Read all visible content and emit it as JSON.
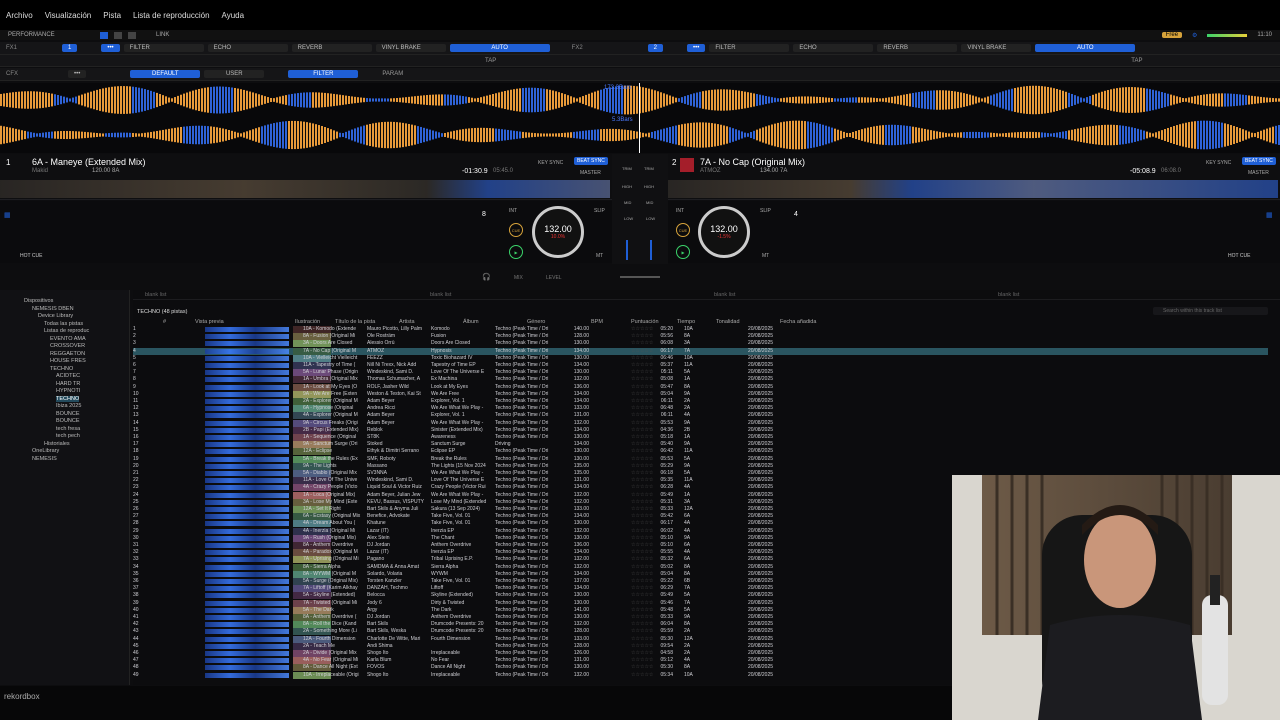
{
  "menu": [
    "Archivo",
    "Visualización",
    "Pista",
    "Lista de reproducción",
    "Ayuda"
  ],
  "topbar": {
    "mode": "PERFORMANCE",
    "link": "LINK",
    "plan": "Free",
    "time": "11:10"
  },
  "fx1": {
    "label": "FX1",
    "effects": [
      "FILTER",
      "ECHO",
      "REVERB",
      "VINYL BRAKE"
    ],
    "auto": "AUTO",
    "tap": "TAP"
  },
  "fx2": {
    "label": "FX2",
    "effects": [
      "FILTER",
      "ECHO",
      "REVERB",
      "VINYL BRAKE"
    ],
    "auto": "AUTO",
    "tap": "TAP"
  },
  "cfx": {
    "label": "CFX",
    "default": "DEFAULT",
    "user": "USER",
    "filter": "FILTER",
    "param": "PARAM"
  },
  "wave_overlay": {
    "bars1": "173.3Bars",
    "bars2": "5.3Bars"
  },
  "deck1": {
    "num": "1",
    "title": "6A - Maneye (Extended Mix)",
    "artist": "Makid",
    "bpm_key": "120.00 8A",
    "time_elapsed": "-01:30.9",
    "time_total": "05:45.0",
    "keysync": "KEY SYNC",
    "beatsync": "BEAT SYNC",
    "master": "MASTER",
    "bpm": "132.00",
    "pitch": "10.0%",
    "int": "INT",
    "slip": "SLIP",
    "cue": "CUE",
    "mt": "MT",
    "beat": "8",
    "hotcue": "HOT CUE"
  },
  "deck2": {
    "num": "2",
    "title": "7A - No Cap (Original Mix)",
    "artist": "ATMOZ",
    "bpm_key": "134.00 7A",
    "time_elapsed": "-05:08.9",
    "time_total": "06:08.0",
    "keysync": "KEY SYNC",
    "beatsync": "BEAT SYNC",
    "master": "MASTER",
    "bpm": "132.00",
    "pitch": "-1.5%",
    "int": "INT",
    "slip": "SLIP",
    "cue": "CUE",
    "mt": "MT",
    "beat": "4",
    "hotcue": "HOT CUE"
  },
  "mixer": {
    "trim": "TRIM",
    "high": "HIGH",
    "mid": "MID",
    "low": "LOW",
    "cue": "CUE",
    "mix": "MIX",
    "level": "LEVEL"
  },
  "sidebar": {
    "items": [
      {
        "label": "Dispositivos"
      },
      {
        "label": "NEMESIS DBEN"
      },
      {
        "label": "Device Library"
      },
      {
        "label": "Todas las pistas"
      },
      {
        "label": "Listas de reproduc"
      },
      {
        "label": "EVENTO AMA"
      },
      {
        "label": "CROSSOVER"
      },
      {
        "label": "REGGAETON"
      },
      {
        "label": "HOUSE FRES"
      },
      {
        "label": "TECHNO"
      },
      {
        "label": "ACIDTEC"
      },
      {
        "label": "HARD TR"
      },
      {
        "label": "HYPNOTI"
      },
      {
        "label": "TECHNO"
      },
      {
        "label": "Ibiza 2025"
      },
      {
        "label": "BOUNCE"
      },
      {
        "label": "BOUNCE"
      },
      {
        "label": "tech fresa"
      },
      {
        "label": "tech pech"
      },
      {
        "label": "Historiales"
      },
      {
        "label": "OneLibrary"
      },
      {
        "label": "NEMESIS"
      }
    ],
    "logo": "rekordbox"
  },
  "tracks": {
    "tabs": [
      "blank list",
      "blank list",
      "blank list",
      "blank list"
    ],
    "playlist": "TECHNO (48 pistas)",
    "search_placeholder": "Search within this track list",
    "headers": [
      "#",
      "Vista previa",
      "Ilustración",
      "Título de la pista",
      "Artista",
      "Álbum",
      "Género",
      "BPM",
      "Puntuación",
      "Tiempo",
      "Tonalidad",
      "Fecha añadida"
    ],
    "rows": [
      [
        "1",
        "10A - Komodo (Extende",
        "Mauro Picotto, Lilly Palm",
        "Komodo",
        "Techno (Peak Time / Dri",
        "140.00",
        "05:20",
        "10A",
        "20/08/2025"
      ],
      [
        "2",
        "8A - Fusion (Original Mi",
        "Ole Rosträm",
        "Fusion",
        "Techno (Peak Time / Dri",
        "128.00",
        "05:56",
        "8A",
        "20/08/2025"
      ],
      [
        "3",
        "3A - Doors Are Closed",
        "Alessio Orrù",
        "Doors Are Closed",
        "Techno (Peak Time / Dri",
        "130.00",
        "06:08",
        "3A",
        "20/08/2025"
      ],
      [
        "4",
        "7A - No Cap (Original M",
        "ATMOZ",
        "Hypnosis",
        "Techno (Peak Time / Dri",
        "134.00",
        "06:17",
        "7A",
        "20/08/2025"
      ],
      [
        "5",
        "10A - Vielleicht Vielleicht",
        "FEEZZ",
        "Toxic Biohazard IV",
        "Techno (Peak Time / Dri",
        "130.00",
        "06:46",
        "10A",
        "20/08/2025"
      ],
      [
        "6",
        "11A - Tapestry of Time (",
        "Nill Ni Trexx, Nick Add",
        "Tapestry of Time EP",
        "Techno (Peak Time / Dri",
        "134.00",
        "05:37",
        "11A",
        "20/08/2025"
      ],
      [
        "7",
        "5A - Lunar Phase (Origin",
        "Windeskind, Sami D.",
        "Love Of The Universe E",
        "Techno (Peak Time / Dri",
        "130.00",
        "05:11",
        "5A",
        "20/08/2025"
      ],
      [
        "8",
        "1A - Umbra (Original Mix",
        "Thomas Schumacher, A",
        "Ex Machina",
        "Techno (Peak Time / Dri",
        "132.00",
        "05:08",
        "1A",
        "20/08/2025"
      ],
      [
        "9",
        "1A - Look at My Eyes (O",
        "ROLF, Jasher Wild",
        "Look at My Eyes",
        "Techno (Peak Time / Dri",
        "136.00",
        "05:47",
        "8A",
        "20/08/2025"
      ],
      [
        "10",
        "9A - We Are Free (Exten",
        "Weston & Teston, Kai St",
        "We Are Free",
        "Techno (Peak Time / Dri",
        "134.00",
        "05:04",
        "9A",
        "20/08/2025"
      ],
      [
        "11",
        "2A - Explorer (Original M",
        "Adam Beyer",
        "Explorer, Vol. 1",
        "Techno (Peak Time / Dri",
        "134.00",
        "06:11",
        "2A",
        "20/08/2025"
      ],
      [
        "12",
        "6A - Hypnose (Original",
        "Andrea Ricci",
        "We Are What We Play -",
        "Techno (Peak Time / Dri",
        "133.00",
        "06:48",
        "2A",
        "20/08/2025"
      ],
      [
        "13",
        "4A - Explorer (Original M",
        "Adam Beyer",
        "Explorer, Vol. 1",
        "Techno (Peak Time / Dri",
        "131.00",
        "06:11",
        "4A",
        "20/08/2025"
      ],
      [
        "14",
        "9A - Circus Freaks (Origi",
        "Adam Beyer",
        "We Are What We Play -",
        "Techno (Peak Time / Dri",
        "132.00",
        "05:53",
        "9A",
        "20/08/2025"
      ],
      [
        "15",
        "2B - Papi (Extended Mix)",
        "Reblok",
        "Sinister (Extended Mix)",
        "Techno (Peak Time / Dri",
        "134.00",
        "04:36",
        "2B",
        "20/08/2025"
      ],
      [
        "16",
        "1A - Sequence (Original",
        "ST8K",
        "Awareness",
        "Techno (Peak Time / Dri",
        "130.00",
        "05:18",
        "1A",
        "20/08/2025"
      ],
      [
        "17",
        "9A - Sanctum Surge (Ori",
        "Stoked",
        "Sanctum Surge",
        "Driving",
        "134.00",
        "05:40",
        "9A",
        "20/08/2025"
      ],
      [
        "18",
        "12A - Eclipse",
        "Ethyk & Dimitri Serrano",
        "Eclipse EP",
        "Techno (Peak Time / Dri",
        "130.00",
        "06:42",
        "11A",
        "20/08/2025"
      ],
      [
        "19",
        "5A - Break the Rules (Ex",
        "SMF, Roboty",
        "Break the Rules",
        "Techno (Peak Time / Dri",
        "130.00",
        "05:53",
        "5A",
        "20/08/2025"
      ],
      [
        "20",
        "9A - The Lights",
        "Massano",
        "The Lights (15 Nov 2024",
        "Techno (Peak Time / Dri",
        "135.00",
        "05:29",
        "9A",
        "20/08/2025"
      ],
      [
        "21",
        "5A - Diablo (Original Mix",
        "SV3NNA",
        "We Are What We Play -",
        "Techno (Peak Time / Dri",
        "135.00",
        "06:18",
        "5A",
        "20/08/2025"
      ],
      [
        "22",
        "11A - Love Of The Unive",
        "Windeskind, Sami D.",
        "Love Of The Universe E",
        "Techno (Peak Time / Dri",
        "131.00",
        "05:35",
        "11A",
        "20/08/2025"
      ],
      [
        "23",
        "4A - Crazy People (Victo",
        "Liquid Soul & Victor Ruiz",
        "Crazy People (Victor Rui",
        "Techno (Peak Time / Dri",
        "134.00",
        "06:28",
        "4A",
        "20/08/2025"
      ],
      [
        "24",
        "1A - Loca (Original Mix)",
        "Adam Beyer, Julian Jew",
        "We Are What We Play -",
        "Techno (Peak Time / Dri",
        "132.00",
        "05:49",
        "1A",
        "20/08/2025"
      ],
      [
        "25",
        "3A - Lose My Mind (Exte",
        "KEVU, Bassus, VISPUTY",
        "Lose My Mind (Extended",
        "Techno (Peak Time / Dri",
        "132.00",
        "05:31",
        "3A",
        "20/08/2025"
      ],
      [
        "26",
        "12A - Set It Right",
        "Bart Skils & Anyma Juli",
        "Sakura (13 Sep 2024)",
        "Techno (Peak Time / Dri",
        "133.00",
        "05:33",
        "12A",
        "20/08/2025"
      ],
      [
        "27",
        "6A - Ecstasy (Original Mix",
        "Benefice, Advokate",
        "Take Five, Vol. 01",
        "Techno (Peak Time / Dri",
        "134.00",
        "05:42",
        "6A",
        "20/08/2025"
      ],
      [
        "28",
        "4A - Dream About You (",
        "Khatune",
        "Take Five, Vol. 01",
        "Techno (Peak Time / Dri",
        "130.00",
        "06:17",
        "4A",
        "20/08/2025"
      ],
      [
        "29",
        "4A - Inerzia (Original Mi",
        "Lazar (IT)",
        "Inerzia EP",
        "Techno (Peak Time / Dri",
        "132.00",
        "06:02",
        "4A",
        "20/08/2025"
      ],
      [
        "30",
        "9A - Rush (Original Mix)",
        "Alex Stein",
        "The Chant",
        "Techno (Peak Time / Dri",
        "130.00",
        "05:10",
        "9A",
        "20/08/2025"
      ],
      [
        "31",
        "8A - Anthem Overdrive",
        "DJ Jordan",
        "Anthem Overdrive",
        "Techno (Peak Time / Dri",
        "136.00",
        "05:10",
        "6A",
        "20/08/2025"
      ],
      [
        "32",
        "4A - Paradox (Original M",
        "Lazar (IT)",
        "Inerzia EP",
        "Techno (Peak Time / Dri",
        "134.00",
        "05:55",
        "4A",
        "20/08/2025"
      ],
      [
        "33",
        "7A - Uprising (Original Mi",
        "Pagano",
        "Tribal Uprising E.P.",
        "Techno (Peak Time / Dri",
        "132.00",
        "05:32",
        "6A",
        "20/08/2025"
      ],
      [
        "34",
        "8A - Sierra Alpha",
        "SAMDMA & Anna Amat",
        "Sierra Alpha",
        "Techno (Peak Time / Dri",
        "132.00",
        "05:02",
        "8A",
        "20/08/2025"
      ],
      [
        "35",
        "8A - WYWM (Original M",
        "Solardo, Volaria",
        "WYWM",
        "Techno (Peak Time / Dri",
        "134.00",
        "05:04",
        "8A",
        "20/08/2025"
      ],
      [
        "36",
        "5A - Surge (Original Mix)",
        "Torsten Kanzler",
        "Take Five, Vol. 01",
        "Techno (Peak Time / Dri",
        "137.00",
        "05:22",
        "6B",
        "20/08/2025"
      ],
      [
        "37",
        "7A - Liftoff (Karim Alkhay",
        "DANZAH, Techmo",
        "Liftoff",
        "Techno (Peak Time / Dri",
        "134.00",
        "06:29",
        "7A",
        "20/08/2025"
      ],
      [
        "38",
        "5A - Skyline (Extended)",
        "Belocca",
        "Skyline (Extended)",
        "Techno (Peak Time / Dri",
        "130.00",
        "05:49",
        "5A",
        "20/08/2025"
      ],
      [
        "39",
        "7A - Twisted (Original Mi",
        "Jody 6",
        "Dirty & Twisted",
        "Techno (Peak Time / Dri",
        "130.00",
        "05:46",
        "7A",
        "20/08/2025"
      ],
      [
        "40",
        "5A - The Dark",
        "Argy",
        "The Dark",
        "Techno (Peak Time / Dri",
        "141.00",
        "05:48",
        "5A",
        "20/08/2025"
      ],
      [
        "41",
        "8A - Anthem Overdrive (",
        "DJ Jordan",
        "Anthem Overdrive",
        "Techno (Peak Time / Dri",
        "130.00",
        "05:33",
        "9A",
        "20/08/2025"
      ],
      [
        "42",
        "8A - Roll the Dice (Kand",
        "Bart Skils",
        "Drumcode Presents: 20",
        "Techno (Peak Time / Dri",
        "132.00",
        "06:04",
        "8A",
        "20/08/2025"
      ],
      [
        "43",
        "2A - Something More (Li",
        "Bart Skils, Weska",
        "Drumcode Presents: 20",
        "Techno (Peak Time / Dri",
        "128.00",
        "05:59",
        "2A",
        "20/08/2025"
      ],
      [
        "44",
        "12A - Fourth Dimension",
        "Charlotte De Witte, Mari",
        "Fourth Dimension",
        "Techno (Peak Time / Dri",
        "133.00",
        "05:30",
        "12A",
        "20/08/2025"
      ],
      [
        "45",
        "2A - Teach Me",
        "Andi Shima",
        "",
        "Techno (Peak Time / Dri",
        "128.00",
        "09:54",
        "2A",
        "20/08/2025"
      ],
      [
        "46",
        "2A - Divide (Original Mix",
        "Shogo Ito",
        "Irreplaceable",
        "Techno (Peak Time / Dri",
        "126.00",
        "04:58",
        "2A",
        "20/08/2025"
      ],
      [
        "47",
        "4A - No Fear (Original Mi",
        "Karla Blum",
        "No Fear",
        "Techno (Peak Time / Dri",
        "131.00",
        "05:12",
        "4A",
        "20/08/2025"
      ],
      [
        "48",
        "8A - Dance All Night (Ext",
        "FOVOS",
        "Dance All Night",
        "Techno (Peak Time / Dri",
        "130.00",
        "05:30",
        "8A",
        "20/08/2025"
      ],
      [
        "49",
        "10A - Irreplaceable (Origi",
        "Shogo Ito",
        "Irreplaceable",
        "Techno (Peak Time / Dri",
        "132.00",
        "05:34",
        "10A",
        "20/08/2025"
      ]
    ]
  },
  "colors": {
    "accent": "#1f5fd6",
    "wave_orange": "#e89a3a",
    "wave_blue": "#2f63d8",
    "selected_row": "#2a5560"
  }
}
